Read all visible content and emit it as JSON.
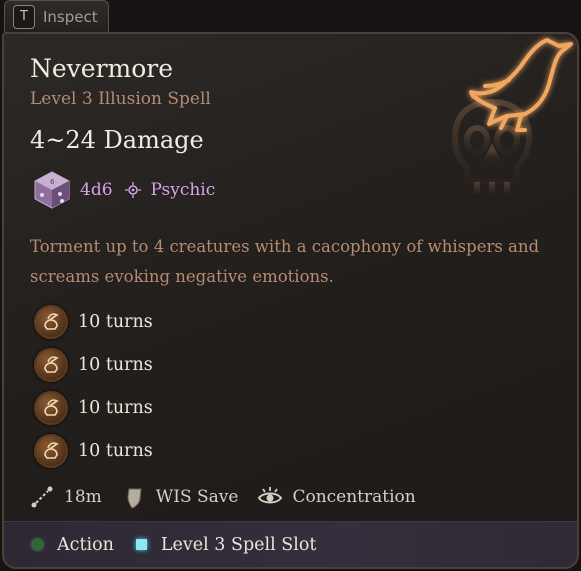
{
  "tab": {
    "key": "T",
    "label": "Inspect"
  },
  "spell": {
    "name": "Nevermore",
    "school": "Level 3 Illusion Spell",
    "damage": "4~24 Damage",
    "dice": "4d6",
    "damage_type": "Psychic",
    "description": "Torment up to 4 creatures with a cacophony of whispers and screams evoking negative emotions."
  },
  "conditions": [
    {
      "icon": "raven-skull-icon",
      "duration": "10 turns"
    },
    {
      "icon": "raven-skull-icon",
      "duration": "10 turns"
    },
    {
      "icon": "raven-skull-icon",
      "duration": "10 turns"
    },
    {
      "icon": "raven-skull-icon",
      "duration": "10 turns"
    }
  ],
  "stats": {
    "range": "18m",
    "save": "WIS Save",
    "concentration": "Concentration"
  },
  "costs": {
    "action": "Action",
    "spell_slot": "Level 3 Spell Slot"
  },
  "colors": {
    "title": "#f2ebe0",
    "subtitle": "#b58c73",
    "psychic": "#d9a2e6",
    "action": "#2b6a35",
    "spell_slot": "#8fe6ef",
    "raven_glow": "#f0a860"
  }
}
